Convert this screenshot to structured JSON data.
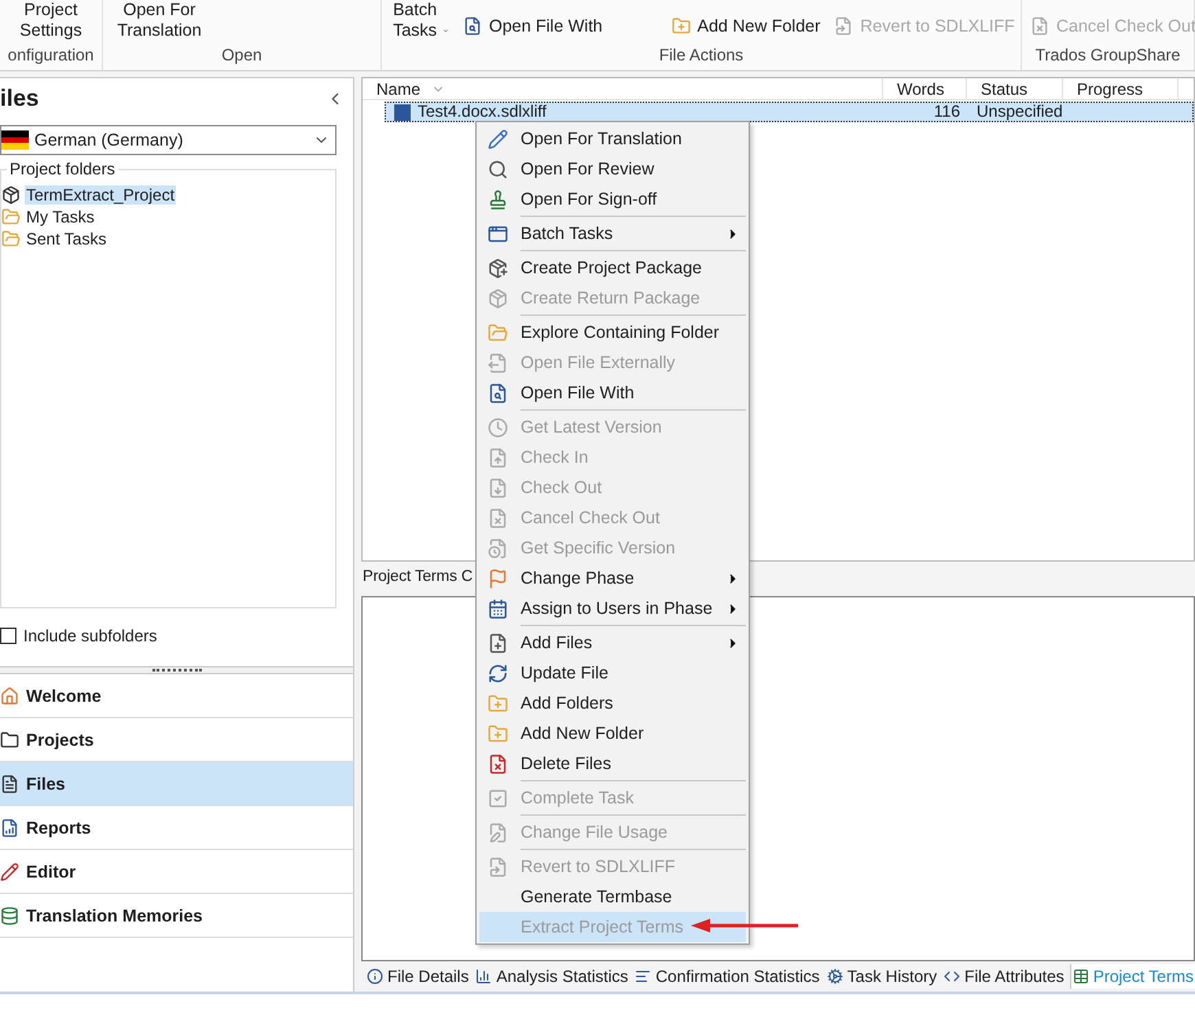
{
  "ribbon": {
    "groups": [
      {
        "label": "onfiguration",
        "buttons": [
          {
            "kind": "large",
            "label": "Project Settings",
            "disabled": false
          }
        ]
      },
      {
        "label": "Open",
        "buttons": [
          {
            "kind": "large",
            "label": "Open For Translation",
            "disabled": false
          }
        ]
      },
      {
        "label": "File Actions",
        "buttons": [
          {
            "kind": "dropdown",
            "label": "Batch Tasks",
            "disabled": false
          },
          {
            "kind": "small",
            "label": "Open File With",
            "disabled": false
          },
          {
            "kind": "small",
            "label": "Add New Folder",
            "disabled": false
          },
          {
            "kind": "small",
            "label": "Revert to SDLXLIFF",
            "disabled": true
          }
        ]
      },
      {
        "label": "Trados GroupShare",
        "buttons": [
          {
            "kind": "small",
            "label": "Cancel Check Out",
            "disabled": true
          }
        ]
      }
    ]
  },
  "sidebar": {
    "title": "iles",
    "language": "German (Germany)",
    "folders_label": "Project folders",
    "folders": [
      {
        "label": "TermExtract_Project",
        "selected": true
      },
      {
        "label": "My Tasks",
        "selected": false
      },
      {
        "label": "Sent Tasks",
        "selected": false
      }
    ],
    "include_subfolders": {
      "label": "Include subfolders",
      "checked": false
    },
    "nav": [
      {
        "label": "Welcome",
        "selected": false
      },
      {
        "label": "Projects",
        "selected": false
      },
      {
        "label": "Files",
        "selected": true
      },
      {
        "label": "Reports",
        "selected": false
      },
      {
        "label": "Editor",
        "selected": false
      },
      {
        "label": "Translation Memories",
        "selected": false
      }
    ]
  },
  "file_list": {
    "columns": [
      "Name",
      "Words",
      "Status",
      "Progress"
    ],
    "rows": [
      {
        "name": "Test4.docx.sdlxliff",
        "words": "116",
        "status": "Unspecified",
        "selected": true
      }
    ]
  },
  "lower_panel": {
    "title": "Project Terms C"
  },
  "bottom_tabs": [
    {
      "label": "File Details",
      "selected": false
    },
    {
      "label": "Analysis Statistics",
      "selected": false
    },
    {
      "label": "Confirmation Statistics",
      "selected": false
    },
    {
      "label": "Task History",
      "selected": false
    },
    {
      "label": "File Attributes",
      "selected": false
    },
    {
      "label": "Project Terms",
      "selected": true
    }
  ],
  "context_menu": {
    "sections": [
      [
        {
          "label": "Open For Translation",
          "disabled": false,
          "submenu": false,
          "selected": false
        },
        {
          "label": "Open For Review",
          "disabled": false,
          "submenu": false,
          "selected": false
        },
        {
          "label": "Open For Sign-off",
          "disabled": false,
          "submenu": false,
          "selected": false
        }
      ],
      [
        {
          "label": "Batch Tasks",
          "disabled": false,
          "submenu": true,
          "selected": false
        }
      ],
      [
        {
          "label": "Create Project Package",
          "disabled": false,
          "submenu": false,
          "selected": false
        },
        {
          "label": "Create Return Package",
          "disabled": true,
          "submenu": false,
          "selected": false
        }
      ],
      [
        {
          "label": "Explore Containing Folder",
          "disabled": false,
          "submenu": false,
          "selected": false
        },
        {
          "label": "Open File Externally",
          "disabled": true,
          "submenu": false,
          "selected": false
        },
        {
          "label": "Open File With",
          "disabled": false,
          "submenu": false,
          "selected": false
        }
      ],
      [
        {
          "label": "Get Latest Version",
          "disabled": true,
          "submenu": false,
          "selected": false
        },
        {
          "label": "Check In",
          "disabled": true,
          "submenu": false,
          "selected": false
        },
        {
          "label": "Check Out",
          "disabled": true,
          "submenu": false,
          "selected": false
        },
        {
          "label": "Cancel Check Out",
          "disabled": true,
          "submenu": false,
          "selected": false
        },
        {
          "label": "Get Specific Version",
          "disabled": true,
          "submenu": false,
          "selected": false
        },
        {
          "label": "Change Phase",
          "disabled": false,
          "submenu": true,
          "selected": false
        },
        {
          "label": "Assign to Users in Phase",
          "disabled": false,
          "submenu": true,
          "selected": false
        }
      ],
      [
        {
          "label": "Add Files",
          "disabled": false,
          "submenu": true,
          "selected": false
        },
        {
          "label": "Update File",
          "disabled": false,
          "submenu": false,
          "selected": false
        },
        {
          "label": "Add Folders",
          "disabled": false,
          "submenu": false,
          "selected": false
        },
        {
          "label": "Add New Folder",
          "disabled": false,
          "submenu": false,
          "selected": false
        },
        {
          "label": "Delete Files",
          "disabled": false,
          "submenu": false,
          "selected": false
        }
      ],
      [
        {
          "label": "Complete Task",
          "disabled": true,
          "submenu": false,
          "selected": false
        }
      ],
      [
        {
          "label": "Change File Usage",
          "disabled": true,
          "submenu": false,
          "selected": false
        }
      ],
      [
        {
          "label": "Revert to SDLXLIFF",
          "disabled": true,
          "submenu": false,
          "selected": false
        },
        {
          "label": "Generate Termbase",
          "disabled": false,
          "submenu": false,
          "selected": false
        },
        {
          "label": "Extract Project Terms",
          "disabled": true,
          "submenu": false,
          "selected": true
        }
      ]
    ]
  }
}
